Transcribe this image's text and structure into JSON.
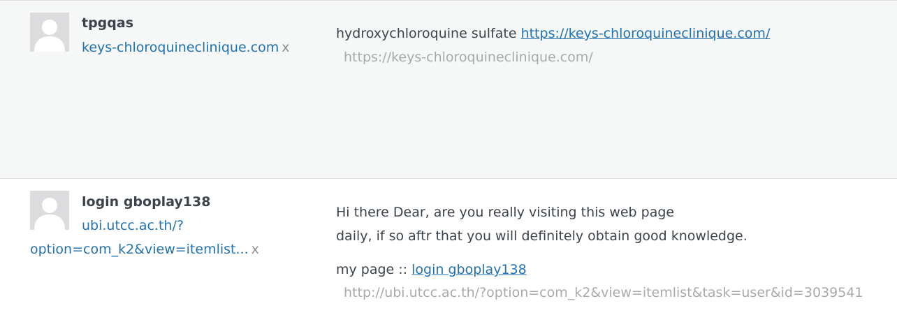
{
  "comments": [
    {
      "author_name": "tpgqas",
      "author_url": "keys-chloroquineclinique.com",
      "remove_label": "x",
      "text_lines": [
        {
          "before": "hydroxychloroquine sulfate ",
          "link": "https://keys-chloroquineclinique.com/"
        }
      ],
      "url_hint": "https://keys-chloroquineclinique.com/"
    },
    {
      "author_name": "login gboplay138",
      "author_url_part1": "ubi.utcc.ac.th/?",
      "author_url_part2": "option=com_k2&view=itemlist...",
      "remove_label": "x",
      "text_line1": "Hi there Dear, are you really visiting this web page",
      "text_line2": "daily, if so aftr that you will definitely obtain good knowledge.",
      "mypage_prefix": "my page :: ",
      "mypage_link": "login gboplay138",
      "url_hint": "http://ubi.utcc.ac.th/?option=com_k2&view=itemlist&task=user&id=3039541"
    }
  ],
  "icons": {
    "avatar": "default-avatar-icon"
  },
  "colors": {
    "link": "#2271b1",
    "text": "#3c434a",
    "muted": "#a7aaad",
    "row_bg_alt": "#f6f7f7"
  }
}
